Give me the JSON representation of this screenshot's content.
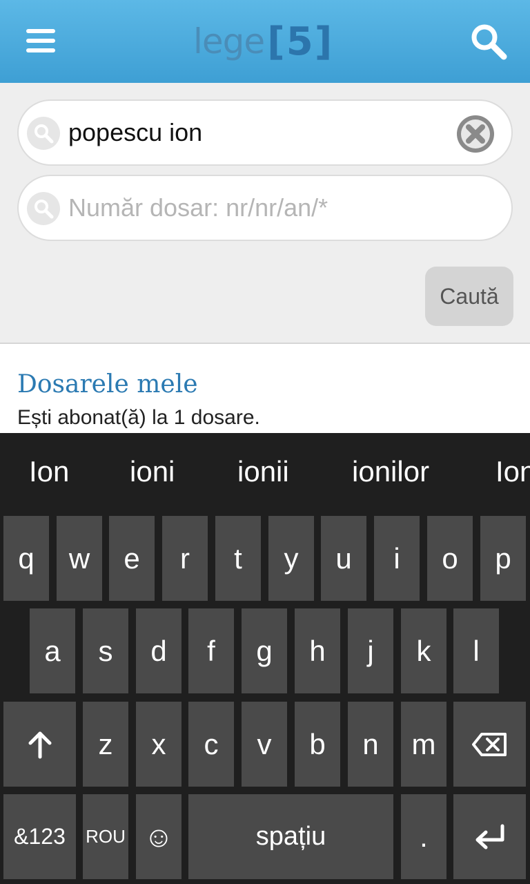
{
  "header": {
    "logo_text": "lege",
    "logo_number": "[5]"
  },
  "search": {
    "name_value": "popescu ion",
    "case_placeholder": "Număr dosar: nr/nr/an/*",
    "button_label": "Caută"
  },
  "content": {
    "title": "Dosarele mele",
    "subtitle": "Ești abonat(ă) la 1 dosare."
  },
  "keyboard": {
    "suggestions": [
      "Ion",
      "ioni",
      "ionii",
      "ionilor",
      "Ion"
    ],
    "row1": [
      "q",
      "w",
      "e",
      "r",
      "t",
      "y",
      "u",
      "i",
      "o",
      "p"
    ],
    "row2": [
      "a",
      "s",
      "d",
      "f",
      "g",
      "h",
      "j",
      "k",
      "l"
    ],
    "row3": [
      "z",
      "x",
      "c",
      "v",
      "b",
      "n",
      "m"
    ],
    "symbols_label": "&123",
    "language_label": "ROU",
    "space_label": "spațiu",
    "period_label": ".",
    "emoji_label": "☺"
  },
  "colors": {
    "header": "#3e9fd4",
    "title": "#2b7ab2",
    "keyboard_bg": "#1f1f1f",
    "key_bg": "#4a4a4a"
  }
}
